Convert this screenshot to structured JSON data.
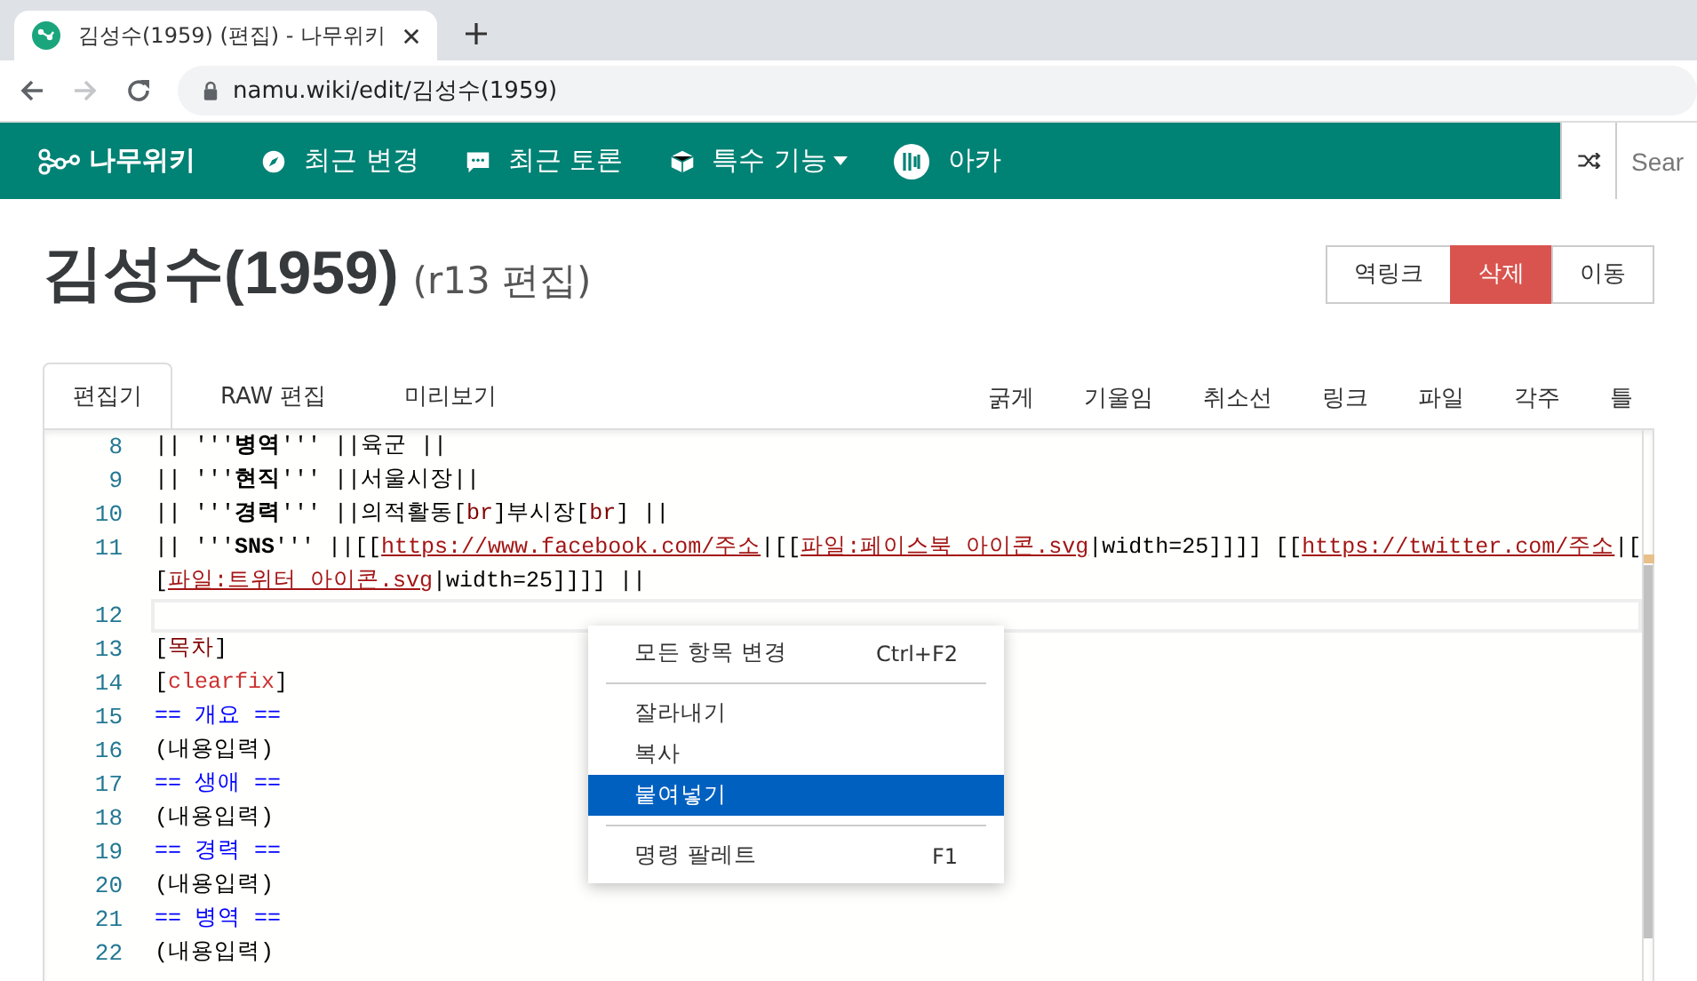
{
  "browser": {
    "tab_title": "김성수(1959) (편집) - 나무위키",
    "url": "namu.wiki/edit/김성수(1959)",
    "forward_disabled": true
  },
  "nav": {
    "logo": "나무위키",
    "items": [
      {
        "kind": "compass",
        "label": "최근 변경"
      },
      {
        "kind": "chat",
        "label": "최근 토론"
      },
      {
        "kind": "cube",
        "label": "특수 기능",
        "dropdown": true
      },
      {
        "kind": "arca",
        "label": "아카"
      }
    ],
    "search": {
      "placeholder": "Sear"
    }
  },
  "page": {
    "title": "김성수(1959)",
    "subtitle": "(r13 편집)",
    "actions": [
      {
        "label": "역링크",
        "danger": false
      },
      {
        "label": "삭제",
        "danger": true
      },
      {
        "label": "이동",
        "danger": false
      }
    ]
  },
  "editor_tabs": [
    {
      "label": "편집기",
      "selected": true
    },
    {
      "label": "RAW 편집",
      "selected": false
    },
    {
      "label": "미리보기",
      "selected": false
    }
  ],
  "toolbar": [
    "굵게",
    "기울임",
    "취소선",
    "링크",
    "파일",
    "각주",
    "틀"
  ],
  "code_lines": [
    {
      "number": "8",
      "current": false,
      "segments": [
        {
          "kind": "plain",
          "text": "|| '''"
        },
        {
          "kind": "bold",
          "text": "병역"
        },
        {
          "kind": "plain",
          "text": "''' ||육군 ||"
        }
      ]
    },
    {
      "number": "9",
      "current": false,
      "segments": [
        {
          "kind": "plain",
          "text": "|| '''"
        },
        {
          "kind": "bold",
          "text": "현직"
        },
        {
          "kind": "plain",
          "text": "''' ||서울시장||"
        }
      ]
    },
    {
      "number": "10",
      "current": false,
      "segments": [
        {
          "kind": "plain",
          "text": "|| '''"
        },
        {
          "kind": "bold",
          "text": "경력"
        },
        {
          "kind": "plain",
          "text": "''' ||의적활동["
        },
        {
          "kind": "macro",
          "text": "br"
        },
        {
          "kind": "plain",
          "text": "]부시장["
        },
        {
          "kind": "macro",
          "text": "br"
        },
        {
          "kind": "plain",
          "text": "] ||"
        }
      ]
    },
    {
      "number": "11",
      "current": false,
      "segments": [
        {
          "kind": "plain",
          "text": "|| '''"
        },
        {
          "kind": "bold",
          "text": "SNS"
        },
        {
          "kind": "plain",
          "text": "''' ||[["
        },
        {
          "kind": "link",
          "text": "https://www.facebook.com/주소"
        },
        {
          "kind": "plain",
          "text": "|[["
        },
        {
          "kind": "link",
          "text": "파일:페이스북 아이콘.svg"
        },
        {
          "kind": "plain",
          "text": "|width=25]]]] [["
        },
        {
          "kind": "link",
          "text": "https://twitter.com/주소"
        },
        {
          "kind": "plain",
          "text": "|["
        },
        {
          "kind": "break"
        },
        {
          "kind": "plain",
          "text": "["
        },
        {
          "kind": "link",
          "text": "파일:트위터 아이콘.svg"
        },
        {
          "kind": "plain",
          "text": "|width=25]]]] ||"
        }
      ]
    },
    {
      "number": "12",
      "current": true
    },
    {
      "number": "13",
      "current": false,
      "segments": [
        {
          "kind": "plain",
          "text": "["
        },
        {
          "kind": "macro",
          "text": "목차"
        },
        {
          "kind": "plain",
          "text": "]"
        }
      ]
    },
    {
      "number": "14",
      "current": false,
      "segments": [
        {
          "kind": "plain",
          "text": "["
        },
        {
          "kind": "special",
          "text": "clearfix"
        },
        {
          "kind": "plain",
          "text": "]"
        }
      ]
    },
    {
      "number": "15",
      "current": false,
      "segments": [
        {
          "kind": "heading",
          "text": "== 개요 =="
        }
      ]
    },
    {
      "number": "16",
      "current": false,
      "segments": [
        {
          "kind": "plain",
          "text": "(내용입력)"
        }
      ]
    },
    {
      "number": "17",
      "current": false,
      "segments": [
        {
          "kind": "heading",
          "text": "== 생애 =="
        }
      ]
    },
    {
      "number": "18",
      "current": false,
      "segments": [
        {
          "kind": "plain",
          "text": "(내용입력)"
        }
      ]
    },
    {
      "number": "19",
      "current": false,
      "segments": [
        {
          "kind": "heading",
          "text": "== 경력 =="
        }
      ]
    },
    {
      "number": "20",
      "current": false,
      "segments": [
        {
          "kind": "plain",
          "text": "(내용입력)"
        }
      ]
    },
    {
      "number": "21",
      "current": false,
      "segments": [
        {
          "kind": "heading",
          "text": "== 병역 =="
        }
      ]
    },
    {
      "number": "22",
      "current": false,
      "segments": [
        {
          "kind": "plain",
          "text": "(내용입력)"
        }
      ]
    }
  ],
  "context_menu": [
    {
      "kind": "item",
      "label": "모든 항목 변경",
      "shortcut": "Ctrl+F2",
      "selected": false
    },
    {
      "kind": "separator"
    },
    {
      "kind": "item",
      "label": "잘라내기",
      "selected": false
    },
    {
      "kind": "item",
      "label": "복사",
      "selected": false
    },
    {
      "kind": "item",
      "label": "붙여넣기",
      "selected": true
    },
    {
      "kind": "separator"
    },
    {
      "kind": "item",
      "label": "명령 팔레트",
      "shortcut": "F1",
      "selected": false
    }
  ]
}
